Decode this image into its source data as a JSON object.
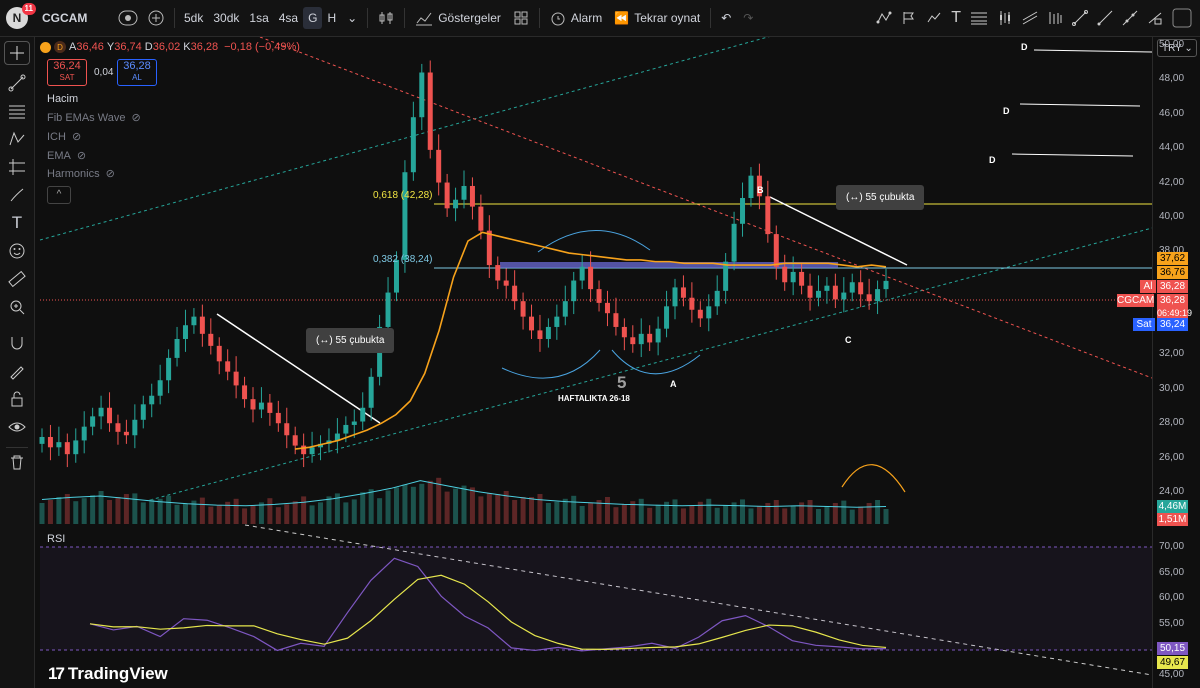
{
  "topbar": {
    "avatar_letter": "N",
    "notifications": "11",
    "symbol": "CGCAM",
    "timeframes": [
      "5dk",
      "30dk",
      "1sa",
      "4sa",
      "G",
      "H"
    ],
    "active_timeframe": "G",
    "indicators_label": "Göstergeler",
    "alarm_label": "Alarm",
    "replay_label": "Tekrar oynat"
  },
  "legend": {
    "symbol_icon_letter": "D",
    "ohlc": [
      {
        "k": "A",
        "v": "36,46"
      },
      {
        "k": "Y",
        "v": "36,74"
      },
      {
        "k": "D",
        "v": "36,02"
      },
      {
        "k": "K",
        "v": "36,28"
      }
    ],
    "change": "−0,18 (−0,49%)",
    "sell_price": "36,24",
    "sell_label": "SAT",
    "spread": "0,04",
    "buy_price": "36,28",
    "buy_label": "AL",
    "indicators": [
      "Hacim",
      "Fib EMAs Wave",
      "ICH",
      "EMA",
      "Harmonics"
    ],
    "collapse": "^"
  },
  "price_axis": {
    "currency": "TRY",
    "labels": [
      "50,00",
      "48,00",
      "46,00",
      "44,00",
      "42,00",
      "40,00",
      "38,00",
      "36,00",
      "34,00",
      "32,00",
      "30,00",
      "28,00",
      "26,00",
      "24,00"
    ],
    "tags": {
      "a": "37,62",
      "b": "36,76",
      "al_marker": "Al",
      "al_value": "36,28",
      "symbol": "CGCAM",
      "last": "36,28",
      "countdown": "06:49:19",
      "sat_marker": "Sat",
      "sat_value": "36,24",
      "vol1": "4,46M",
      "vol2": "1,51M"
    },
    "rsi_labels": [
      "70,00",
      "65,00",
      "60,00",
      "55,00",
      "50,00",
      "45,00"
    ],
    "rsi_tags": {
      "rsi": "50,15",
      "ma": "49,67"
    }
  },
  "annotations": {
    "fib_618": "0,618 (42,28)",
    "fib_382": "0,382 (38,24)",
    "bars_label_1": "55 çubukta",
    "bars_label_2": "55 çubukta",
    "point_B": "B",
    "point_C": "C",
    "point_A": "A",
    "wave_5": "5",
    "weekly_note": "HAFTALIKTA 26-18",
    "d_labels": [
      "D",
      "D",
      "D"
    ],
    "rsi_title": "RSI",
    "brand": "TradingView"
  },
  "colors": {
    "up": "#26a69a",
    "down": "#ef5350",
    "ema": "#f7a21b",
    "fib": "#f0e442",
    "rsi": "#7e57c2",
    "rsi_ma": "#e6e64d"
  },
  "chart_data": {
    "type": "candlestick",
    "title": "CGCAM",
    "ylim": [
      23,
      51
    ],
    "close_approx": [
      27.2,
      26.6,
      26.9,
      26.2,
      27.0,
      27.8,
      28.4,
      28.9,
      28.0,
      27.5,
      27.3,
      28.2,
      29.1,
      29.6,
      30.5,
      31.8,
      32.9,
      33.7,
      34.2,
      33.2,
      32.5,
      31.6,
      31.0,
      30.2,
      29.4,
      28.8,
      29.2,
      28.6,
      28.0,
      27.3,
      26.7,
      26.2,
      26.6,
      26.8,
      27.0,
      27.4,
      27.9,
      28.1,
      28.9,
      30.7,
      33.6,
      35.6,
      37.5,
      42.6,
      45.8,
      48.4,
      43.9,
      42.0,
      40.5,
      41.0,
      41.8,
      40.6,
      39.2,
      37.2,
      36.3,
      36.0,
      35.1,
      34.2,
      33.4,
      32.9,
      33.6,
      34.2,
      35.1,
      36.3,
      37.1,
      35.8,
      35.0,
      34.4,
      33.6,
      33.0,
      32.6,
      33.2,
      32.7,
      33.5,
      34.8,
      35.9,
      35.3,
      34.6,
      34.1,
      34.8,
      35.7,
      37.4,
      39.6,
      41.1,
      42.4,
      41.2,
      39.0,
      37.1,
      36.2,
      36.8,
      36.0,
      35.3,
      35.7,
      36.0,
      35.2,
      35.6,
      36.2,
      35.5,
      35.1,
      35.8,
      36.28
    ],
    "ema_approx": [
      26.5,
      26.6,
      26.8,
      27.0,
      27.3,
      27.6,
      28.0,
      28.5,
      29.3,
      30.9,
      33.4,
      36.5,
      38.6,
      39.1,
      38.9,
      38.7,
      38.5,
      38.3,
      38.1,
      37.9,
      37.8,
      37.7,
      37.6,
      37.5,
      37.5,
      37.4,
      37.4,
      37.3,
      37.3,
      37.3,
      37.2,
      37.2,
      37.2,
      37.2,
      37.3,
      37.3,
      37.3,
      37.3,
      37.2,
      37.1,
      37.2,
      37.1
    ],
    "volume_approx": [
      3.5,
      3.8,
      4.0,
      3.6,
      3.2,
      2.9,
      2.7,
      2.6,
      2.8,
      3.1,
      3.6,
      4.3,
      5.1,
      6.2,
      5.4,
      4.6,
      4.0,
      3.5,
      3.2,
      3.0,
      2.8,
      2.7,
      2.6,
      2.7,
      2.6,
      2.5,
      2.6,
      2.5,
      2.4,
      2.5
    ],
    "rsi_approx": [
      55.0,
      53.8,
      54.5,
      52.5,
      56.0,
      55.7,
      54.2,
      52.5,
      49.8,
      51.2,
      50.6,
      57.2,
      63.5,
      67.8,
      66.2,
      60.4,
      56.5,
      54.2,
      50.3,
      49.8,
      50.4,
      49.7,
      50.1,
      50.5,
      51.2,
      50.2,
      52.4,
      55.6,
      56.6,
      54.4,
      51.7,
      50.8,
      50.5,
      50.1,
      50.15
    ],
    "rsi_ylim": [
      45,
      70
    ]
  }
}
